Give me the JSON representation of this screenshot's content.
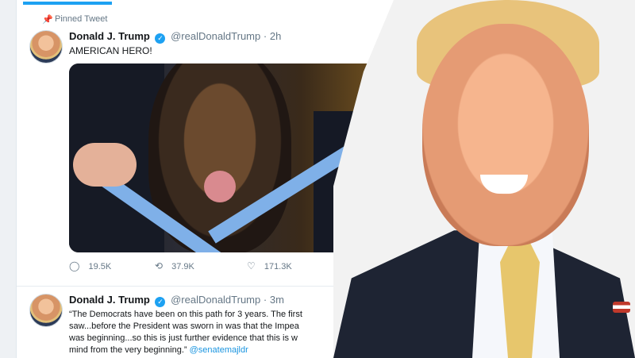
{
  "pinned": {
    "label": "Pinned Tweet"
  },
  "tweet1": {
    "name": "Donald J. Trump",
    "handle": "@realDonaldTrump",
    "sep": "·",
    "time": "2h",
    "text": "AMERICAN HERO!",
    "actions": {
      "replies": "19.5K",
      "retweets": "37.9K",
      "likes": "171.3K"
    }
  },
  "tweet2": {
    "name": "Donald J. Trump",
    "handle": "@realDonaldTrump",
    "sep": "·",
    "time": "3m",
    "text_line1": "“The Democrats have been on this path for 3 years. The first",
    "text_line2": "saw...before the President was sworn in was that the Impea",
    "text_line3": "was beginning...so this is just further evidence that this is w",
    "text_line4": "mind from the very beginning.”",
    "mention": "@senatemajldr"
  },
  "colors": {
    "accent": "#1da1f2",
    "bg": "#eef1f4",
    "text": "#14171a",
    "muted": "#657786"
  },
  "icons": [
    "pin-icon",
    "verified-icon",
    "chevron-down-icon",
    "reply-icon",
    "retweet-icon",
    "like-icon",
    "share-icon"
  ]
}
